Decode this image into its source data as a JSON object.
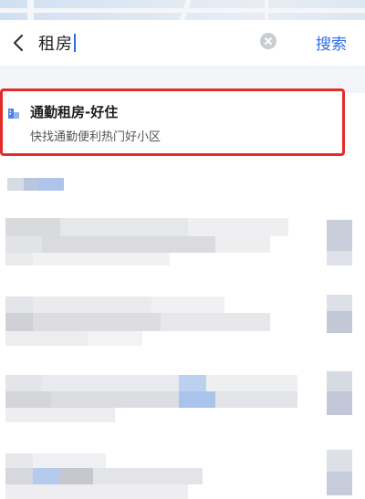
{
  "search": {
    "value": "租房",
    "submit_label": "搜索"
  },
  "suggestion": {
    "title": "通勤租房-好住",
    "subtitle": "快找通勤便利热门好小区"
  },
  "icons": {
    "back": "chevron-left-icon",
    "clear": "clear-icon",
    "suggestion": "building-icon"
  },
  "colors": {
    "accent": "#2d6de0",
    "highlight": "#e52a2a"
  }
}
